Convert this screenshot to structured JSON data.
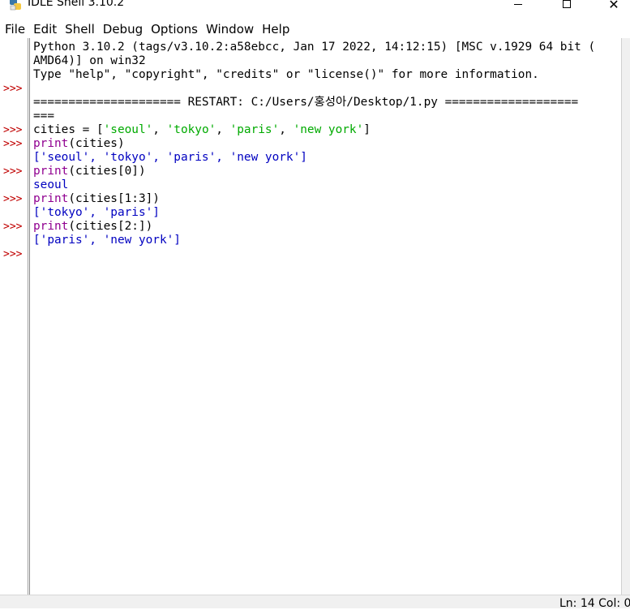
{
  "window": {
    "title": "IDLE Shell 3.10.2",
    "minimize_glyph": "",
    "maximize_glyph": "",
    "close_glyph": "✕"
  },
  "menu": [
    "File",
    "Edit",
    "Shell",
    "Debug",
    "Options",
    "Window",
    "Help"
  ],
  "shell": {
    "banner_line1": "Python 3.10.2 (tags/v3.10.2:a58ebcc, Jan 17 2022, 14:12:15) [MSC v.1929 64 bit (",
    "banner_line2": "AMD64)] on win32",
    "banner_line3": "Type \"help\", \"copyright\", \"credits\" or \"license()\" for more information.",
    "restart_line1": "===================== RESTART: C:/Users/홍성아/Desktop/1.py ===================",
    "restart_line2": "===",
    "prompt": ">>>",
    "lines": {
      "l1_a": "cities = [",
      "l1_s1": "'seoul'",
      "l1_c1": ", ",
      "l1_s2": "'tokyo'",
      "l1_c2": ", ",
      "l1_s3": "'paris'",
      "l1_c3": ", ",
      "l1_s4": "'new york'",
      "l1_b": "]",
      "l2_fn": "print",
      "l2_rest": "(cities)",
      "l3_out": "['seoul', 'tokyo', 'paris', 'new york']",
      "l4_fn": "print",
      "l4_rest": "(cities[0])",
      "l5_out": "seoul",
      "l6_fn": "print",
      "l6_rest": "(cities[1:3])",
      "l7_out": "['tokyo', 'paris']",
      "l8_fn": "print",
      "l8_rest": "(cities[2:])",
      "l9_out": "['paris', 'new york']"
    }
  },
  "status": {
    "position": "Ln: 14   Col: 0"
  },
  "colors": {
    "string": "#00aa00",
    "builtin": "#900090",
    "output": "#0000c0",
    "prompt": "#c00000"
  }
}
